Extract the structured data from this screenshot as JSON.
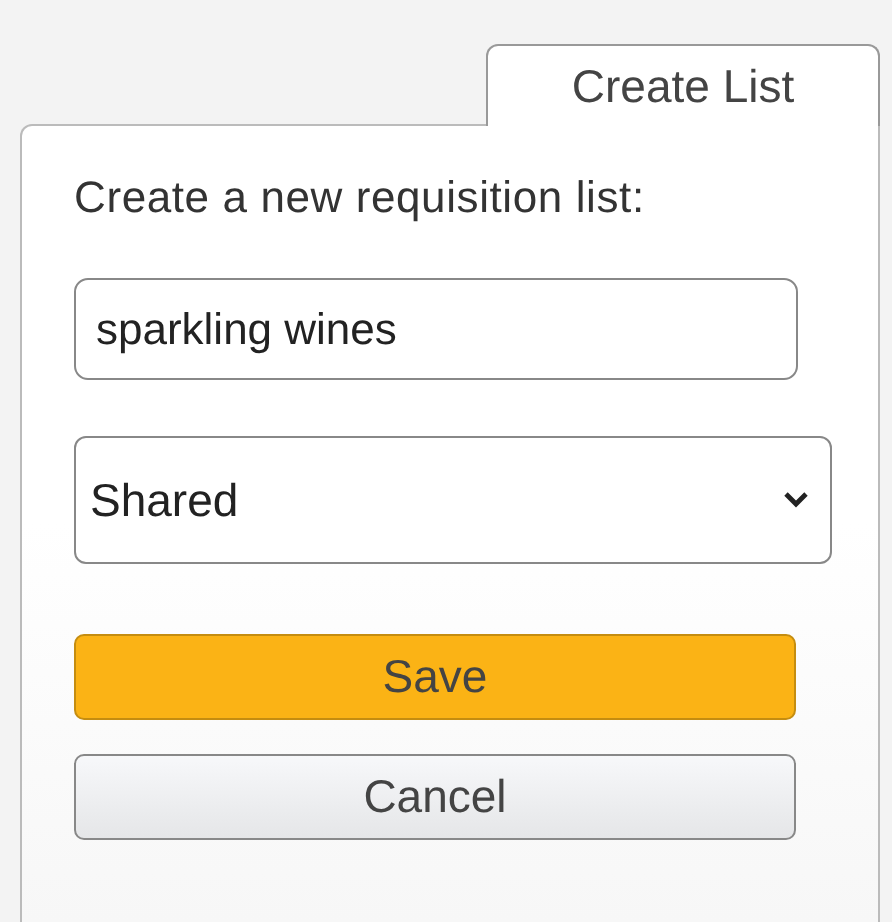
{
  "tab": {
    "label": "Create List",
    "selected": true
  },
  "heading": "Create a new requisition list:",
  "name_field": {
    "value": "sparkling wines"
  },
  "visibility_select": {
    "value": "Shared"
  },
  "buttons": [
    {
      "label": "Save",
      "kind": "primary"
    },
    {
      "label": "Cancel",
      "kind": "secondary"
    }
  ]
}
